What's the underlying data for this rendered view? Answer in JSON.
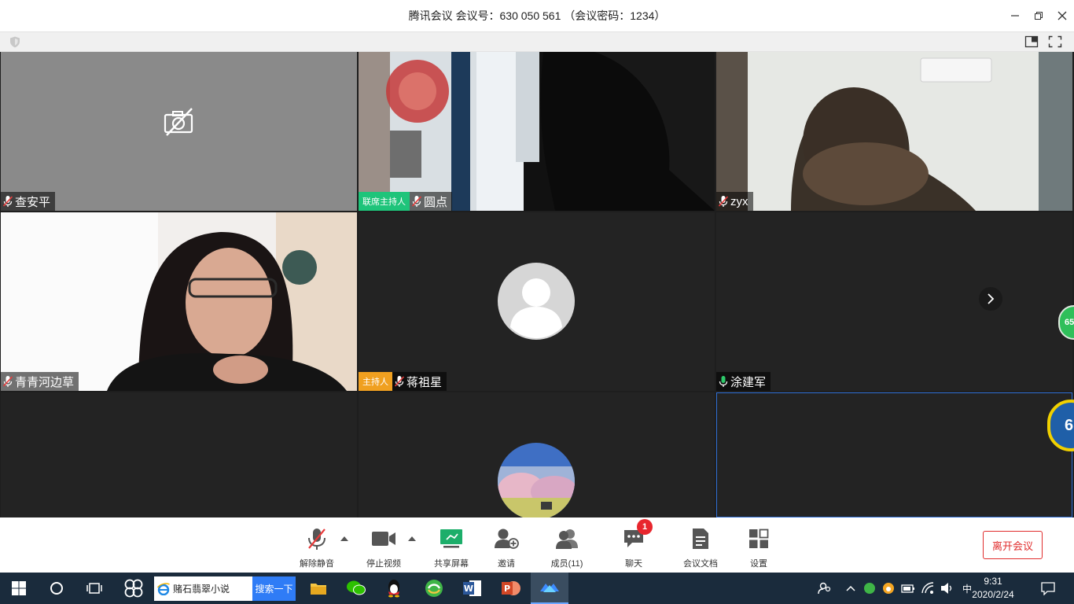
{
  "window": {
    "title": "腾讯会议 会议号：630 050 561 （会议密码：1234）"
  },
  "participants": [
    {
      "name": "查安平",
      "role": "",
      "mic": "muted",
      "video": "off"
    },
    {
      "name": "圆点",
      "role": "联席主持人",
      "mic": "muted",
      "video": "on"
    },
    {
      "name": "zyx",
      "role": "",
      "mic": "muted",
      "video": "on"
    },
    {
      "name": "青青河边草",
      "role": "",
      "mic": "muted",
      "video": "on"
    },
    {
      "name": "蒋祖星",
      "role": "主持人",
      "mic": "muted",
      "video": "avatar"
    },
    {
      "name": "涂建军",
      "role": "",
      "mic": "active",
      "video": "none"
    }
  ],
  "toolbar": {
    "unmute": "解除静音",
    "stop_video": "停止视频",
    "share_screen": "共享屏幕",
    "invite": "邀请",
    "members": "成员(11)",
    "chat": "聊天",
    "chat_badge": "1",
    "docs": "会议文档",
    "settings": "设置",
    "leave": "离开会议"
  },
  "side_widgets": {
    "top": "65",
    "bottom": "6"
  },
  "taskbar": {
    "search_text": "赌石翡翠小说",
    "search_button": "搜索一下",
    "ime": "中",
    "time": "9:31",
    "date": "2020/2/24"
  },
  "colors": {
    "co_host_badge": "#1ec47a",
    "host_badge": "#f0a020",
    "leave_button": "#e02c2c",
    "chat_badge": "#e8262d",
    "taskbar": "#1a2b3c"
  }
}
